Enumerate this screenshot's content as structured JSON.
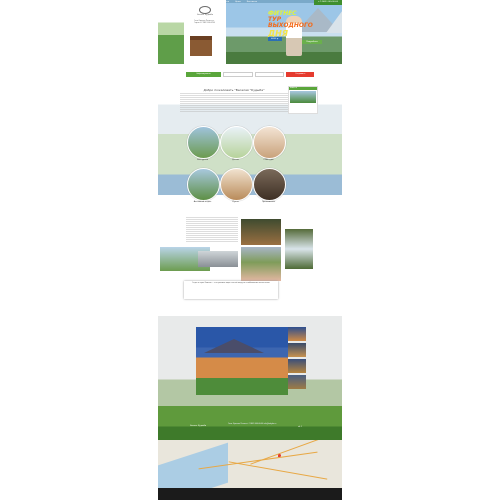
{
  "header": {
    "logo_text": "Эколог Кудыба",
    "nav": [
      "Главная",
      "О нас",
      "Туры",
      "Фото",
      "Цены",
      "Контакты"
    ],
    "phone": "+7 (862) 000-00-00",
    "contacts": "Сочи, Красная Поляна\nул. Горная\n+7 (862) 000-00-00",
    "promo": {
      "line1": "ФИТНЕС",
      "line2": "ТУР ВЫХОДНОГО",
      "line3": "ДНЯ",
      "button": "Подробнее"
    },
    "price": "4000 р."
  },
  "booking": {
    "button": "Забронировать",
    "submit": "Отправить"
  },
  "welcome": {
    "title": "Добро пожаловать \"Веселая \"Кудыба\"",
    "sidebar_title": "Новости"
  },
  "features": [
    {
      "label": "Экскурсии"
    },
    {
      "label": "Детям"
    },
    {
      "label": "СПА-туры"
    },
    {
      "label": "Активный отдых"
    },
    {
      "label": "Кухня"
    },
    {
      "label": "Проживание"
    }
  ],
  "about": {
    "quote": "Отдых в горах Кавказа — это красивые виды, чистый воздух и незабываемые впечатления."
  },
  "footer": {
    "logo": "Эколог Кудыба",
    "contacts": "Сочи, Красная Поляна\n+7 (862) 000-00-00\ninfo@kudyba.ru",
    "social": "vk  f"
  },
  "colors": {
    "accent_green": "#5aa63b",
    "accent_red": "#e53b2f",
    "blue": "#2b6fb5"
  }
}
